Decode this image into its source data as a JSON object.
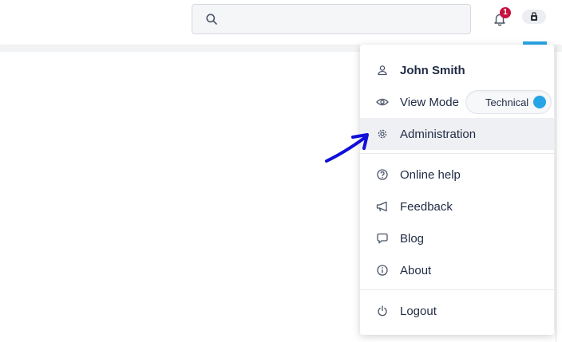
{
  "header": {
    "search": {
      "placeholder": "",
      "value": ""
    },
    "notifications": {
      "count": "1"
    }
  },
  "menu": {
    "user_name": "John Smith",
    "view_mode": {
      "label": "View Mode",
      "value": "Technical"
    },
    "items": [
      {
        "label": "Administration",
        "icon": "gear-icon"
      },
      {
        "label": "Online help",
        "icon": "help-circle-icon"
      },
      {
        "label": "Feedback",
        "icon": "megaphone-icon"
      },
      {
        "label": "Blog",
        "icon": "chat-bubble-icon"
      },
      {
        "label": "About",
        "icon": "info-icon"
      }
    ],
    "logout_label": "Logout"
  },
  "colors": {
    "accent": "#27a3e7",
    "badge": "#c8103e",
    "text": "#1f2a44",
    "arrow": "#1010d8"
  }
}
